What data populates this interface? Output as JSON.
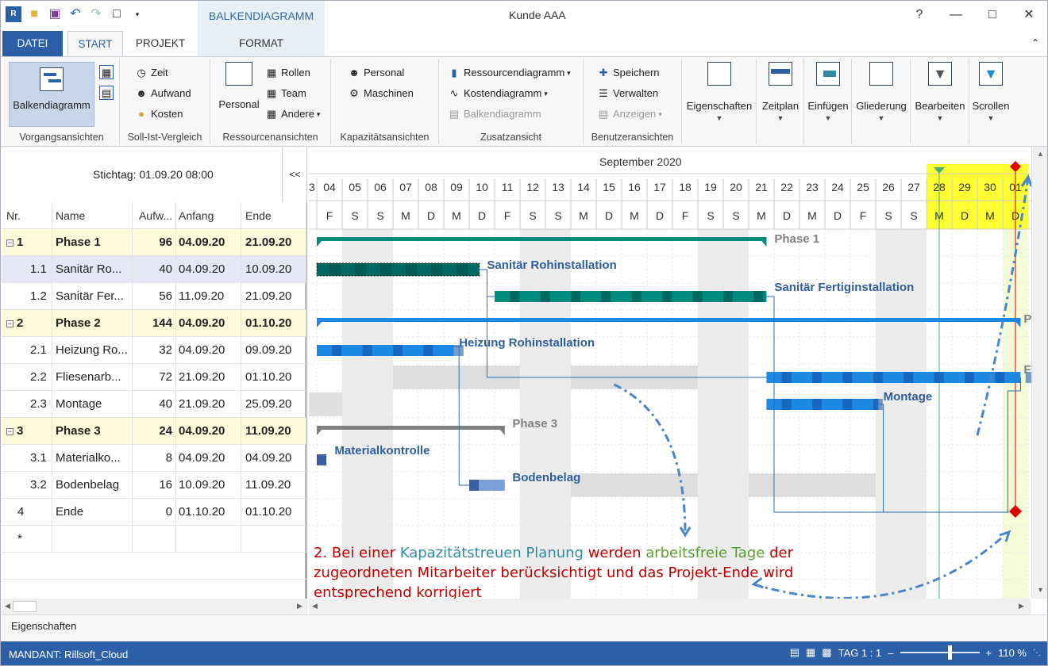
{
  "window": {
    "title": "Kunde AAA",
    "context_group": "BALKENDIAGRAMM"
  },
  "quick_access": [
    "app-logo-icon",
    "open-folder-icon",
    "save-icon",
    "undo-icon",
    "redo-icon",
    "window-icon",
    "dropdown-icon"
  ],
  "tabs": {
    "datei": "DATEI",
    "start": "START",
    "projekt": "PROJEKT",
    "format": "FORMAT"
  },
  "ribbon": {
    "vorgang": {
      "label": "Vorgangsansichten",
      "balken": "Balkendiagramm"
    },
    "sollist": {
      "label": "Soll-Ist-Vergleich",
      "zeit": "Zeit",
      "aufwand": "Aufwand",
      "kosten": "Kosten"
    },
    "ressource": {
      "label": "Ressourcenansichten",
      "personal": "Personal",
      "rollen": "Rollen",
      "team": "Team",
      "andere": "Andere"
    },
    "kapazitaet": {
      "label": "Kapazitätsansichten",
      "personal": "Personal",
      "maschinen": "Maschinen"
    },
    "zusatz": {
      "label": "Zusatzansicht",
      "ressourcendiagramm": "Ressourcendiagramm",
      "kostendiagramm": "Kostendiagramm",
      "balkendiagramm": "Balkendiagramm"
    },
    "benutzer": {
      "label": "Benutzeransichten",
      "speichern": "Speichern",
      "verwalten": "Verwalten",
      "anzeigen": "Anzeigen"
    },
    "tools": {
      "eigenschaften": "Eigenschaften",
      "zeitplan": "Zeitplan",
      "einfuegen": "Einfügen",
      "gliederung": "Gliederung",
      "bearbeiten": "Bearbeiten",
      "scrollen": "Scrollen"
    }
  },
  "stichtag": "Stichtag: 01.09.20 08:00",
  "collapse_label": "<<",
  "columns": {
    "nr": "Nr.",
    "name": "Name",
    "aufw": "Aufw...",
    "anfang": "Anfang",
    "ende": "Ende"
  },
  "rows": [
    {
      "nr": "1",
      "name": "Phase 1",
      "aufw": "96",
      "anfang": "04.09.20",
      "ende": "21.09.20",
      "kind": "phase"
    },
    {
      "nr": "1.1",
      "name": "Sanitär Ro...",
      "aufw": "40",
      "anfang": "04.09.20",
      "ende": "10.09.20",
      "kind": "sel"
    },
    {
      "nr": "1.2",
      "name": "Sanitär Fer...",
      "aufw": "56",
      "anfang": "11.09.20",
      "ende": "21.09.20",
      "kind": "task"
    },
    {
      "nr": "2",
      "name": "Phase 2",
      "aufw": "144",
      "anfang": "04.09.20",
      "ende": "01.10.20",
      "kind": "phase"
    },
    {
      "nr": "2.1",
      "name": "Heizung Ro...",
      "aufw": "32",
      "anfang": "04.09.20",
      "ende": "09.09.20",
      "kind": "task"
    },
    {
      "nr": "2.2",
      "name": "Fliesenarb...",
      "aufw": "72",
      "anfang": "21.09.20",
      "ende": "01.10.20",
      "kind": "task"
    },
    {
      "nr": "2.3",
      "name": "Montage",
      "aufw": "40",
      "anfang": "21.09.20",
      "ende": "25.09.20",
      "kind": "task"
    },
    {
      "nr": "3",
      "name": "Phase 3",
      "aufw": "24",
      "anfang": "04.09.20",
      "ende": "11.09.20",
      "kind": "phase"
    },
    {
      "nr": "3.1",
      "name": "Materialko...",
      "aufw": "8",
      "anfang": "04.09.20",
      "ende": "04.09.20",
      "kind": "task"
    },
    {
      "nr": "3.2",
      "name": "Bodenbelag",
      "aufw": "16",
      "anfang": "10.09.20",
      "ende": "11.09.20",
      "kind": "task"
    },
    {
      "nr": "4",
      "name": "Ende",
      "aufw": "0",
      "anfang": "01.10.20",
      "ende": "01.10.20",
      "kind": "milestone"
    },
    {
      "nr": "*",
      "name": "",
      "aufw": "",
      "anfang": "",
      "ende": "",
      "kind": "new"
    }
  ],
  "timeline": {
    "month": "September 2020",
    "first_partial": "3",
    "days": [
      "04",
      "05",
      "06",
      "07",
      "08",
      "09",
      "10",
      "11",
      "12",
      "13",
      "14",
      "15",
      "16",
      "17",
      "18",
      "19",
      "20",
      "21",
      "22",
      "23",
      "24",
      "25",
      "26",
      "27",
      "28",
      "29",
      "30",
      "01"
    ],
    "weekdays": [
      "F",
      "S",
      "S",
      "M",
      "D",
      "M",
      "D",
      "F",
      "S",
      "S",
      "M",
      "D",
      "M",
      "D",
      "F",
      "S",
      "S",
      "M",
      "D",
      "M",
      "D",
      "F",
      "S",
      "S",
      "M",
      "D",
      "M",
      "D"
    ],
    "highlight_days": [
      "28",
      "29",
      "30",
      "01"
    ]
  },
  "gantt_labels": {
    "phase1": "Phase 1",
    "sanitaer_roh": "Sanitär Rohinstallation",
    "sanitaer_fertig": "Sanitär Fertiginstallation",
    "phase2_cut": "P",
    "heizung": "Heizung Rohinstallation",
    "fliesen_cut": "F",
    "montage": "Montage",
    "phase3": "Phase 3",
    "material": "Materialkontrolle",
    "boden": "Bodenbelag"
  },
  "annotation": {
    "p1": "2. Bei einer ",
    "p2": "Kapazitätstreuen Planung",
    "p3": " werden ",
    "p4": "arbeitsfreie Tage",
    "p5": " der",
    "line2": "zugeordneten Mitarbeiter berücksichtigt und das Projekt-Ende wird",
    "line3": "entsprechend korrigiert",
    "colors": {
      "main": "#c00000",
      "blue": "#2e8ba8",
      "green": "#5a9e2f"
    }
  },
  "colors": {
    "teal": "#008a80",
    "blue": "#1e88e5",
    "gray_bar": "#7f7f7f",
    "milestone": "#e00000",
    "highlight": "#ffff33",
    "status": "#2b5fa8"
  },
  "properties_label": "Eigenschaften",
  "status": {
    "mandant": "MANDANT: Rillsoft_Cloud",
    "tag": "TAG 1 : 1",
    "zoom": "110 %"
  }
}
